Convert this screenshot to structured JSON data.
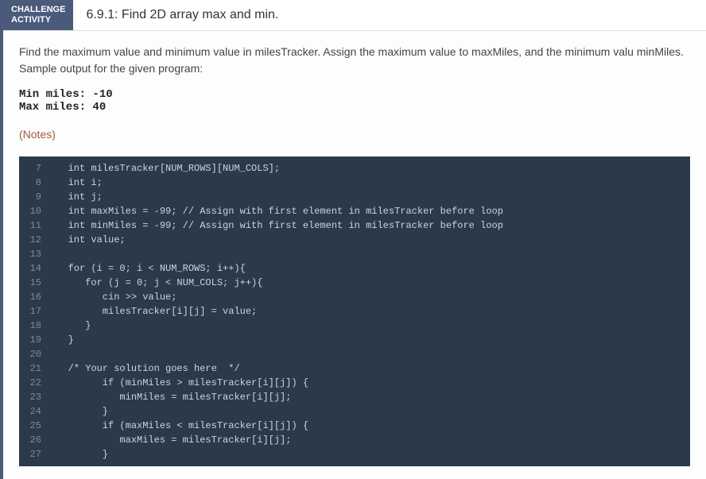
{
  "header": {
    "label_line1": "CHALLENGE",
    "label_line2": "ACTIVITY",
    "title": "6.9.1: Find 2D array max and min."
  },
  "instructions": {
    "text": "Find the maximum value and minimum value in milesTracker. Assign the maximum value to maxMiles, and the minimum valu minMiles. Sample output for the given program:"
  },
  "sample_output": {
    "line1": "Min miles: -10",
    "line2": "Max miles: 40"
  },
  "notes_label": "(Notes)",
  "code": {
    "lines": [
      {
        "n": "7",
        "t": "   int milesTracker[NUM_ROWS][NUM_COLS];"
      },
      {
        "n": "8",
        "t": "   int i;"
      },
      {
        "n": "9",
        "t": "   int j;"
      },
      {
        "n": "10",
        "t": "   int maxMiles = -99; // Assign with first element in milesTracker before loop"
      },
      {
        "n": "11",
        "t": "   int minMiles = -99; // Assign with first element in milesTracker before loop"
      },
      {
        "n": "12",
        "t": "   int value;"
      },
      {
        "n": "13",
        "t": ""
      },
      {
        "n": "14",
        "t": "   for (i = 0; i < NUM_ROWS; i++){"
      },
      {
        "n": "15",
        "t": "      for (j = 0; j < NUM_COLS; j++){"
      },
      {
        "n": "16",
        "t": "         cin >> value;"
      },
      {
        "n": "17",
        "t": "         milesTracker[i][j] = value;"
      },
      {
        "n": "18",
        "t": "      }"
      },
      {
        "n": "19",
        "t": "   }"
      },
      {
        "n": "20",
        "t": ""
      },
      {
        "n": "21",
        "t": "   /* Your solution goes here  */"
      },
      {
        "n": "22",
        "t": "         if (minMiles > milesTracker[i][j]) {"
      },
      {
        "n": "23",
        "t": "            minMiles = milesTracker[i][j];"
      },
      {
        "n": "24",
        "t": "         }"
      },
      {
        "n": "25",
        "t": "         if (maxMiles < milesTracker[i][j]) {"
      },
      {
        "n": "26",
        "t": "            maxMiles = milesTracker[i][j];"
      },
      {
        "n": "27",
        "t": "         }"
      }
    ]
  }
}
